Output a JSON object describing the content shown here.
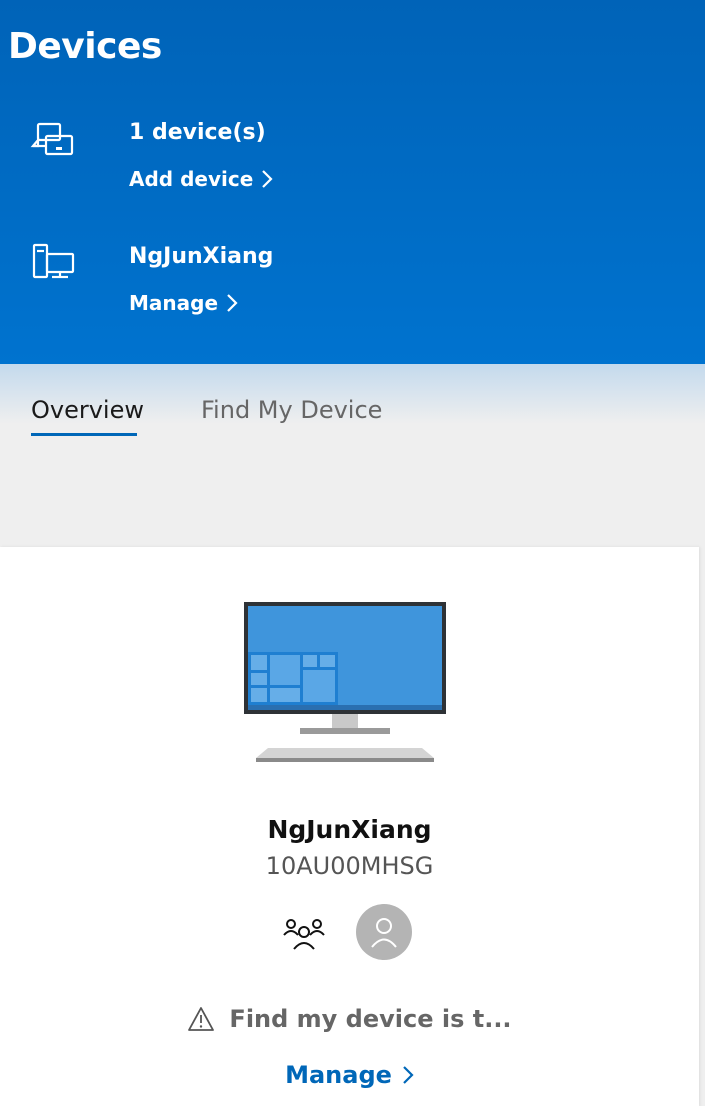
{
  "header": {
    "title": "Devices",
    "devices_count": "1 device(s)",
    "add_device": "Add device",
    "device_name": "NgJunXiang",
    "manage": "Manage"
  },
  "tabs": [
    {
      "label": "Overview",
      "active": true
    },
    {
      "label": "Find My Device",
      "active": false
    }
  ],
  "device_card": {
    "name": "NgJunXiang",
    "model": "10AU00MHSG",
    "icons": [
      "family-icon",
      "user-avatar-icon"
    ],
    "warning": "Find my device is t...",
    "manage": "Manage"
  },
  "colors": {
    "header_blue": "#0067b8",
    "link_blue": "#0067b8",
    "avatar_gray": "#b4b4b4"
  }
}
